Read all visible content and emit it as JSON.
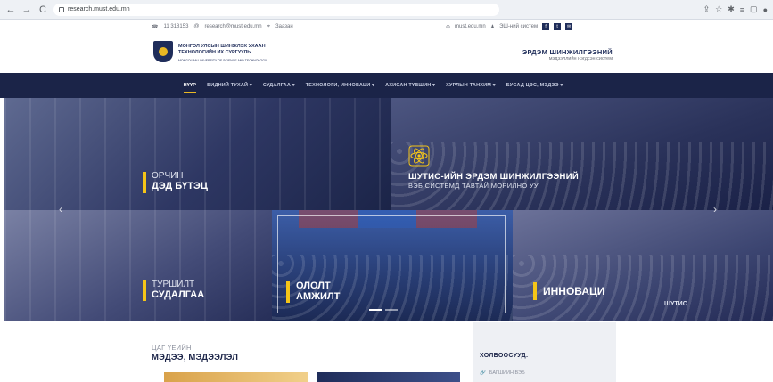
{
  "browser": {
    "back": "←",
    "forward": "→",
    "reload": "C",
    "url": "research.must.edu.mn",
    "right_icons": [
      "share-icon",
      "star-icon",
      "extensions-icon",
      "reading-icon",
      "window-icon",
      "profile-icon"
    ]
  },
  "contact": {
    "phone": "11 318153",
    "email": "research@must.edu.mn",
    "address": "Заазан",
    "site": "must.edu.mn",
    "login": "ЭШ-ний систем"
  },
  "header": {
    "uni_name": "МОНГОЛ УЛСЫН ШИНЖЛЭХ УХААН ТЕХНОЛОГИЙН ИХ СУРГУУЛЬ",
    "uni_sub": "MONGOLIAN UNIVERSITY OF SCIENCE AND TECHNOLOGY",
    "portal_title": "ЭРДЭМ ШИНЖИЛГЭЭНИЙ",
    "portal_sub": "мэдээллийн нэгдсэн систем"
  },
  "menu": [
    {
      "label": "НҮҮР",
      "active": true
    },
    {
      "label": "БИДНИЙ ТУХАЙ ▾"
    },
    {
      "label": "СУДАЛГАА ▾"
    },
    {
      "label": "ТЕХНОЛОГИ, ИННОВАЦИ ▾"
    },
    {
      "label": "АХИСАН ТҮВШИН ▾"
    },
    {
      "label": "ХУРЛЫН ТАНХИМ ▾"
    },
    {
      "label": "БУСАД ЦЭС, МЭДЭЭ ▾"
    }
  ],
  "hero": {
    "infra_light": "ОРЧИН",
    "infra_bold": "ДЭД БҮТЭЦ",
    "welcome_title": "ШУТИС-ИЙН ЭРДЭМ ШИНЖИЛГЭЭНИЙ",
    "welcome_sub": "ВЭБ СИСТЕМД ТАВТАЙ МОРИЛНО УУ",
    "research_light": "ТУРШИЛТ",
    "research_bold": "СУДАЛГАА",
    "success_line1": "ОЛОЛТ",
    "success_line2": "АМЖИЛТ",
    "innov": "ИННОВАЦИ",
    "innov_logo_text": "ШУТИС",
    "arrow_left": "‹",
    "arrow_right": "›"
  },
  "news": {
    "label_small": "ЦАГ ҮЕИЙН",
    "label_big": "МЭДЭЭ, МЭДЭЭЛЭЛ"
  },
  "links": {
    "title": "ХОЛБООСУУД:",
    "first": "БАГШИЙН ВЭБ"
  },
  "colors": {
    "navy": "#1b2448",
    "accent": "#f5c518"
  }
}
